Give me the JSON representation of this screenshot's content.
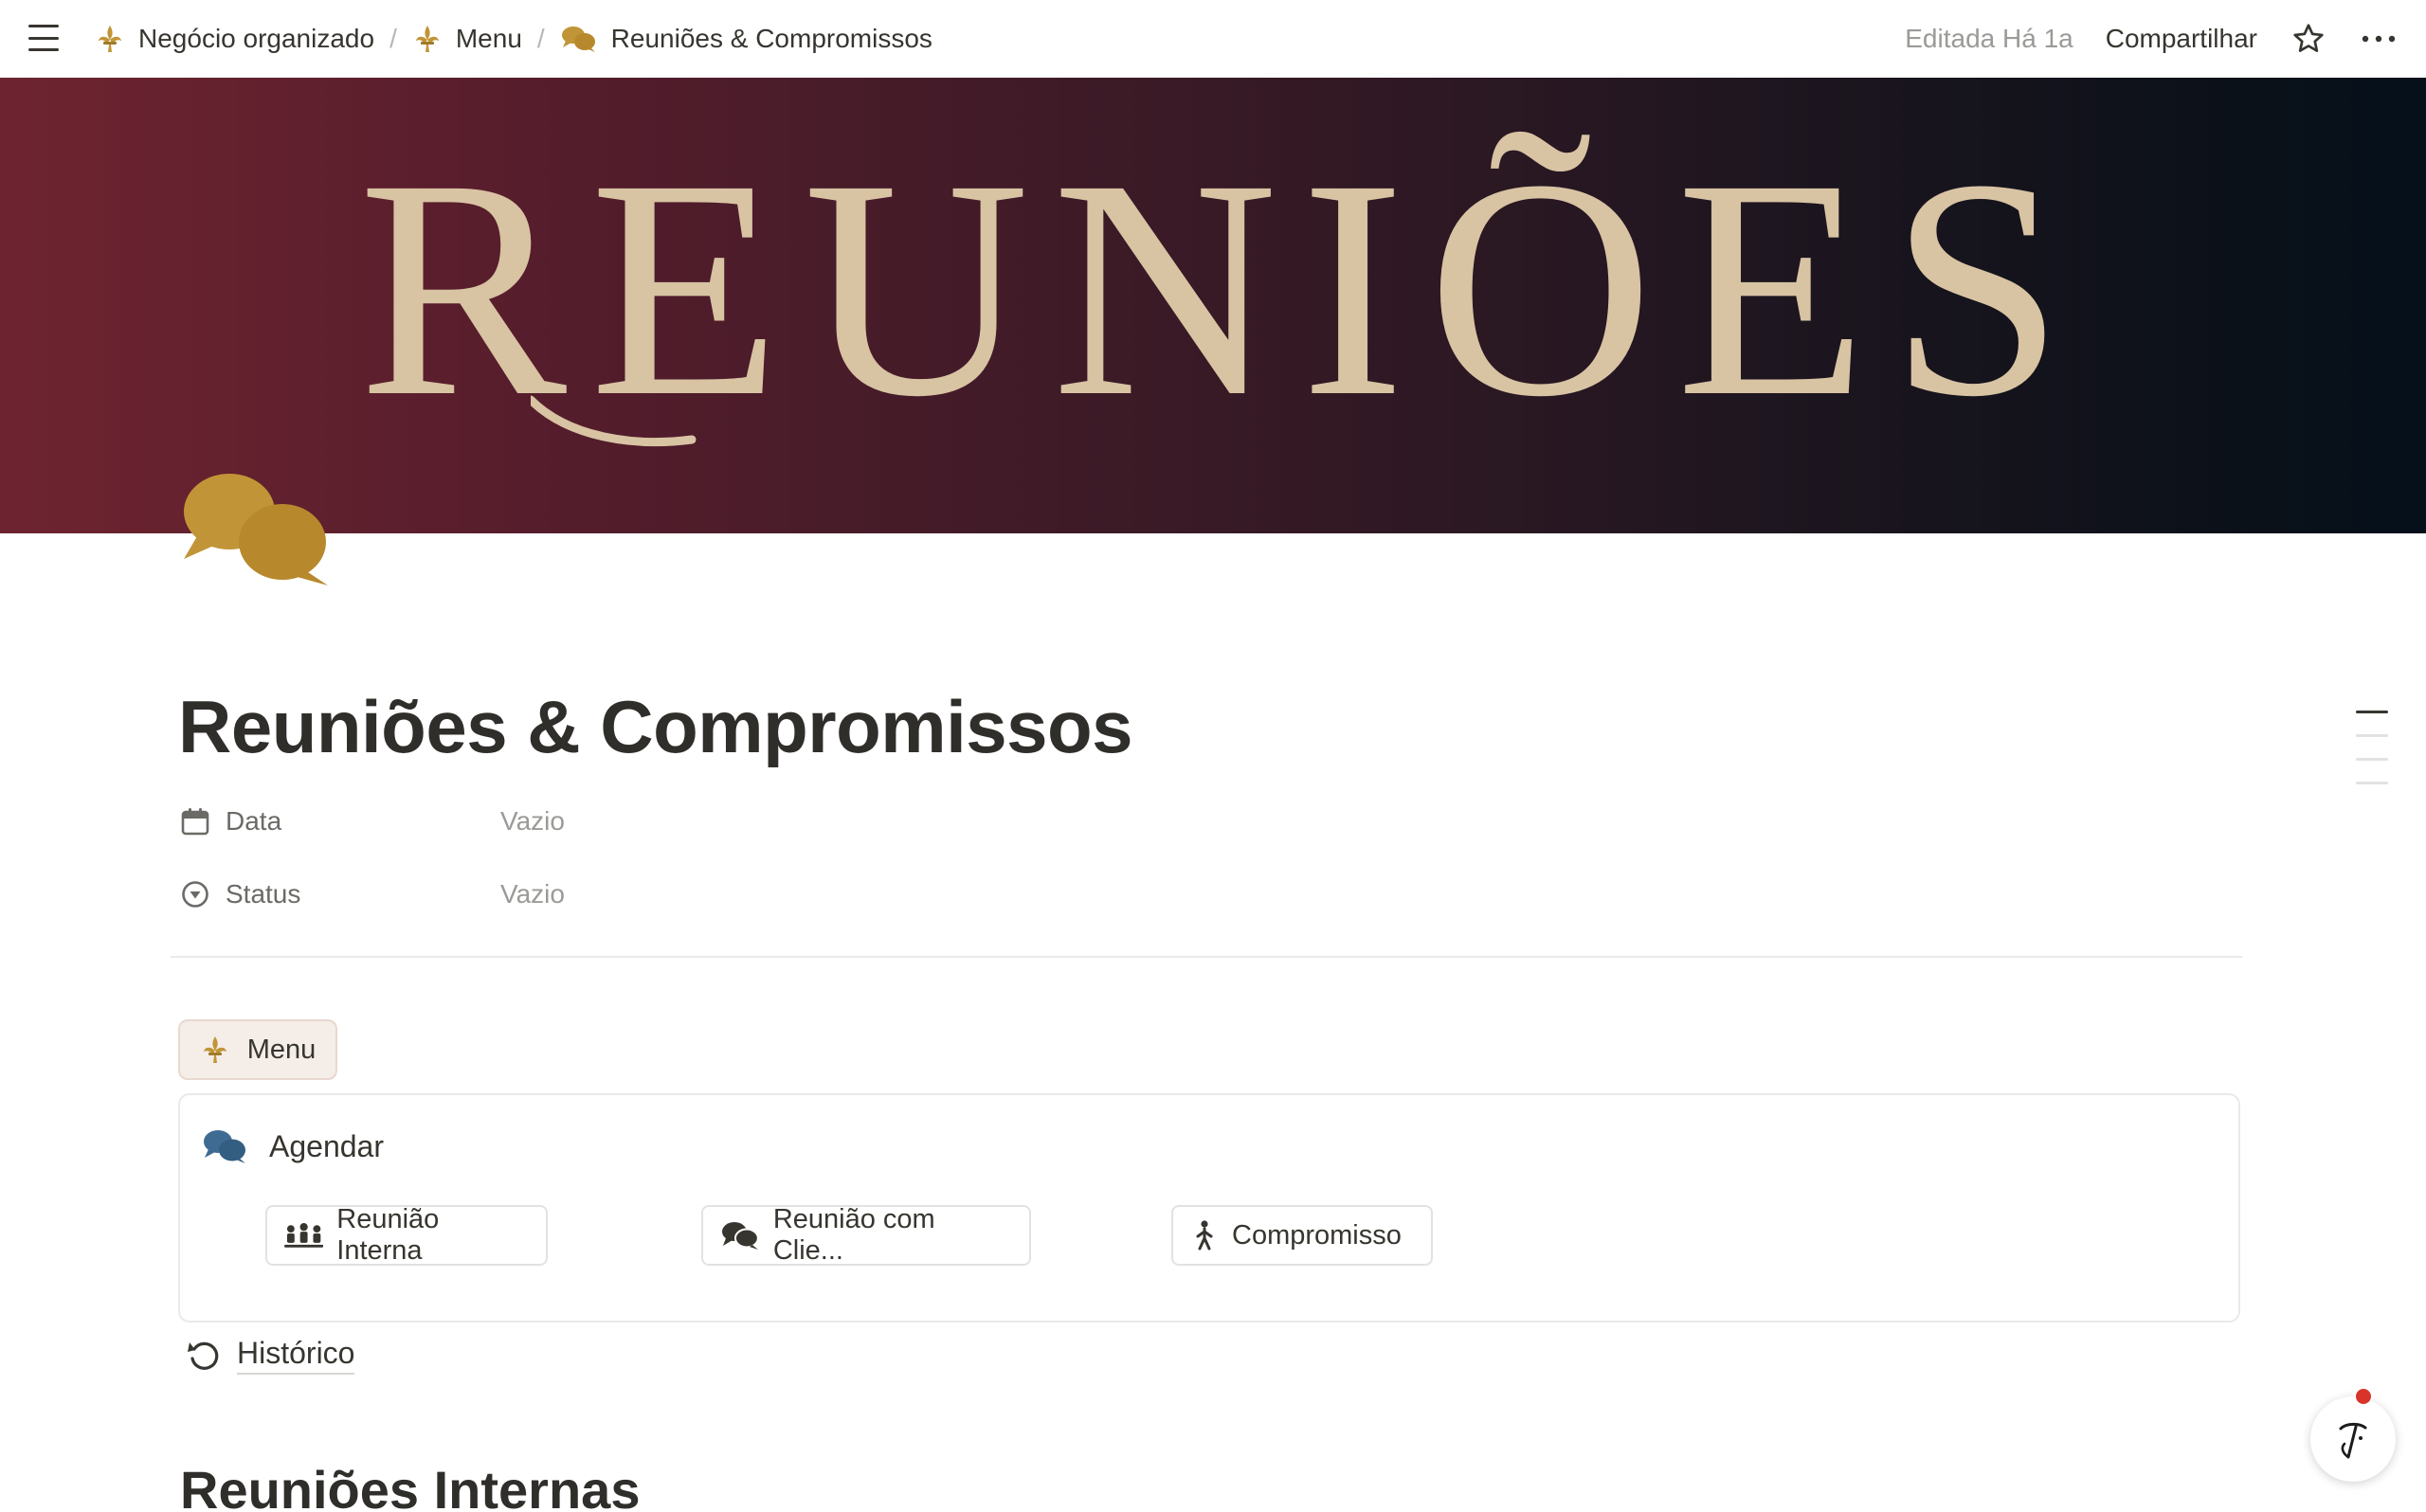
{
  "topbar": {
    "breadcrumbs": [
      {
        "label": "Negócio organizado",
        "icon": "fleur-de-lis-icon"
      },
      {
        "label": "Menu",
        "icon": "fleur-de-lis-icon"
      },
      {
        "label": "Reuniões & Compromissos",
        "icon": "speech-bubbles-icon"
      }
    ],
    "separator": "/",
    "edited": "Editada Há 1a",
    "share": "Compartilhar"
  },
  "cover": {
    "text": "REUNIÕES",
    "gradient_colors": [
      "#6e2430",
      "#3a1a26",
      "#05101a"
    ],
    "text_color": "#d8c3a3"
  },
  "page": {
    "title": "Reuniões & Compromissos",
    "icon": "speech-bubbles-icon",
    "icon_color": "#c19537"
  },
  "properties": [
    {
      "name": "Data",
      "icon": "calendar-icon",
      "value": "Vazio"
    },
    {
      "name": "Status",
      "icon": "status-icon",
      "value": "Vazio"
    }
  ],
  "menu_button": {
    "label": "Menu",
    "icon": "fleur-de-lis-icon"
  },
  "agendar": {
    "title": "Agendar",
    "icon": "speech-bubbles-icon",
    "icon_color": "#3f6b93",
    "buttons": [
      {
        "label": "Reunião Interna",
        "icon": "people-group-icon"
      },
      {
        "label": "Reunião com Clie...",
        "icon": "speech-bubbles-icon"
      },
      {
        "label": "Compromisso",
        "icon": "walking-person-icon"
      }
    ]
  },
  "historico": {
    "label": "Histórico",
    "icon": "history-icon"
  },
  "section_heading": "Reuniões Internas"
}
